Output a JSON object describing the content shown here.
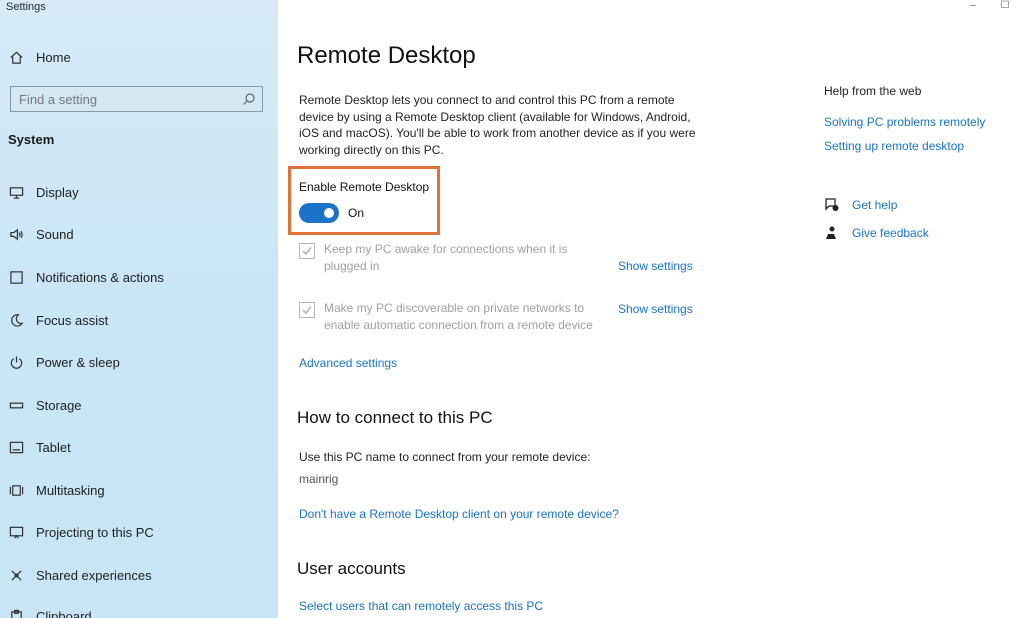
{
  "app": {
    "title": "Settings",
    "minimize_glyph": "–",
    "maximize_glyph": "☐"
  },
  "sidebar": {
    "home_label": "Home",
    "search_placeholder": "Find a setting",
    "section_title": "System",
    "items": [
      {
        "label": "Display",
        "icon": "display-icon"
      },
      {
        "label": "Sound",
        "icon": "sound-icon"
      },
      {
        "label": "Notifications & actions",
        "icon": "notifications-icon"
      },
      {
        "label": "Focus assist",
        "icon": "moon-icon"
      },
      {
        "label": "Power & sleep",
        "icon": "power-icon"
      },
      {
        "label": "Storage",
        "icon": "storage-icon"
      },
      {
        "label": "Tablet",
        "icon": "tablet-icon"
      },
      {
        "label": "Multitasking",
        "icon": "multitasking-icon"
      },
      {
        "label": "Projecting to this PC",
        "icon": "projecting-icon"
      },
      {
        "label": "Shared experiences",
        "icon": "shared-experiences-icon"
      },
      {
        "label": "Clipboard",
        "icon": "clipboard-icon"
      }
    ]
  },
  "main": {
    "title": "Remote Desktop",
    "intro": "Remote Desktop lets you connect to and control this PC from a remote device by using a Remote Desktop client (available for Windows, Android, iOS and macOS). You'll be able to work from another device as if you were working directly on this PC.",
    "toggle": {
      "label": "Enable Remote Desktop",
      "state": "On",
      "checked": true,
      "accent": "#1a73c9"
    },
    "highlight_color": "#e0733a",
    "options": [
      {
        "text": "Keep my PC awake for connections when it is plugged in",
        "checked": true,
        "link": "Show settings"
      },
      {
        "text": "Make my PC discoverable on private networks to enable automatic connection from a remote device",
        "checked": true,
        "link": "Show settings"
      }
    ],
    "advanced_link": "Advanced settings",
    "connect": {
      "heading": "How to connect to this PC",
      "instruction": "Use this PC name to connect from your remote device:",
      "pc_name": "mainrig",
      "client_link": "Don't have a Remote Desktop client on your remote device?"
    },
    "accounts": {
      "heading": "User accounts",
      "link": "Select users that can remotely access this PC"
    }
  },
  "help": {
    "heading": "Help from the web",
    "links": [
      "Solving PC problems remotely",
      "Setting up remote desktop"
    ],
    "get_help": "Get help",
    "give_feedback": "Give feedback"
  }
}
